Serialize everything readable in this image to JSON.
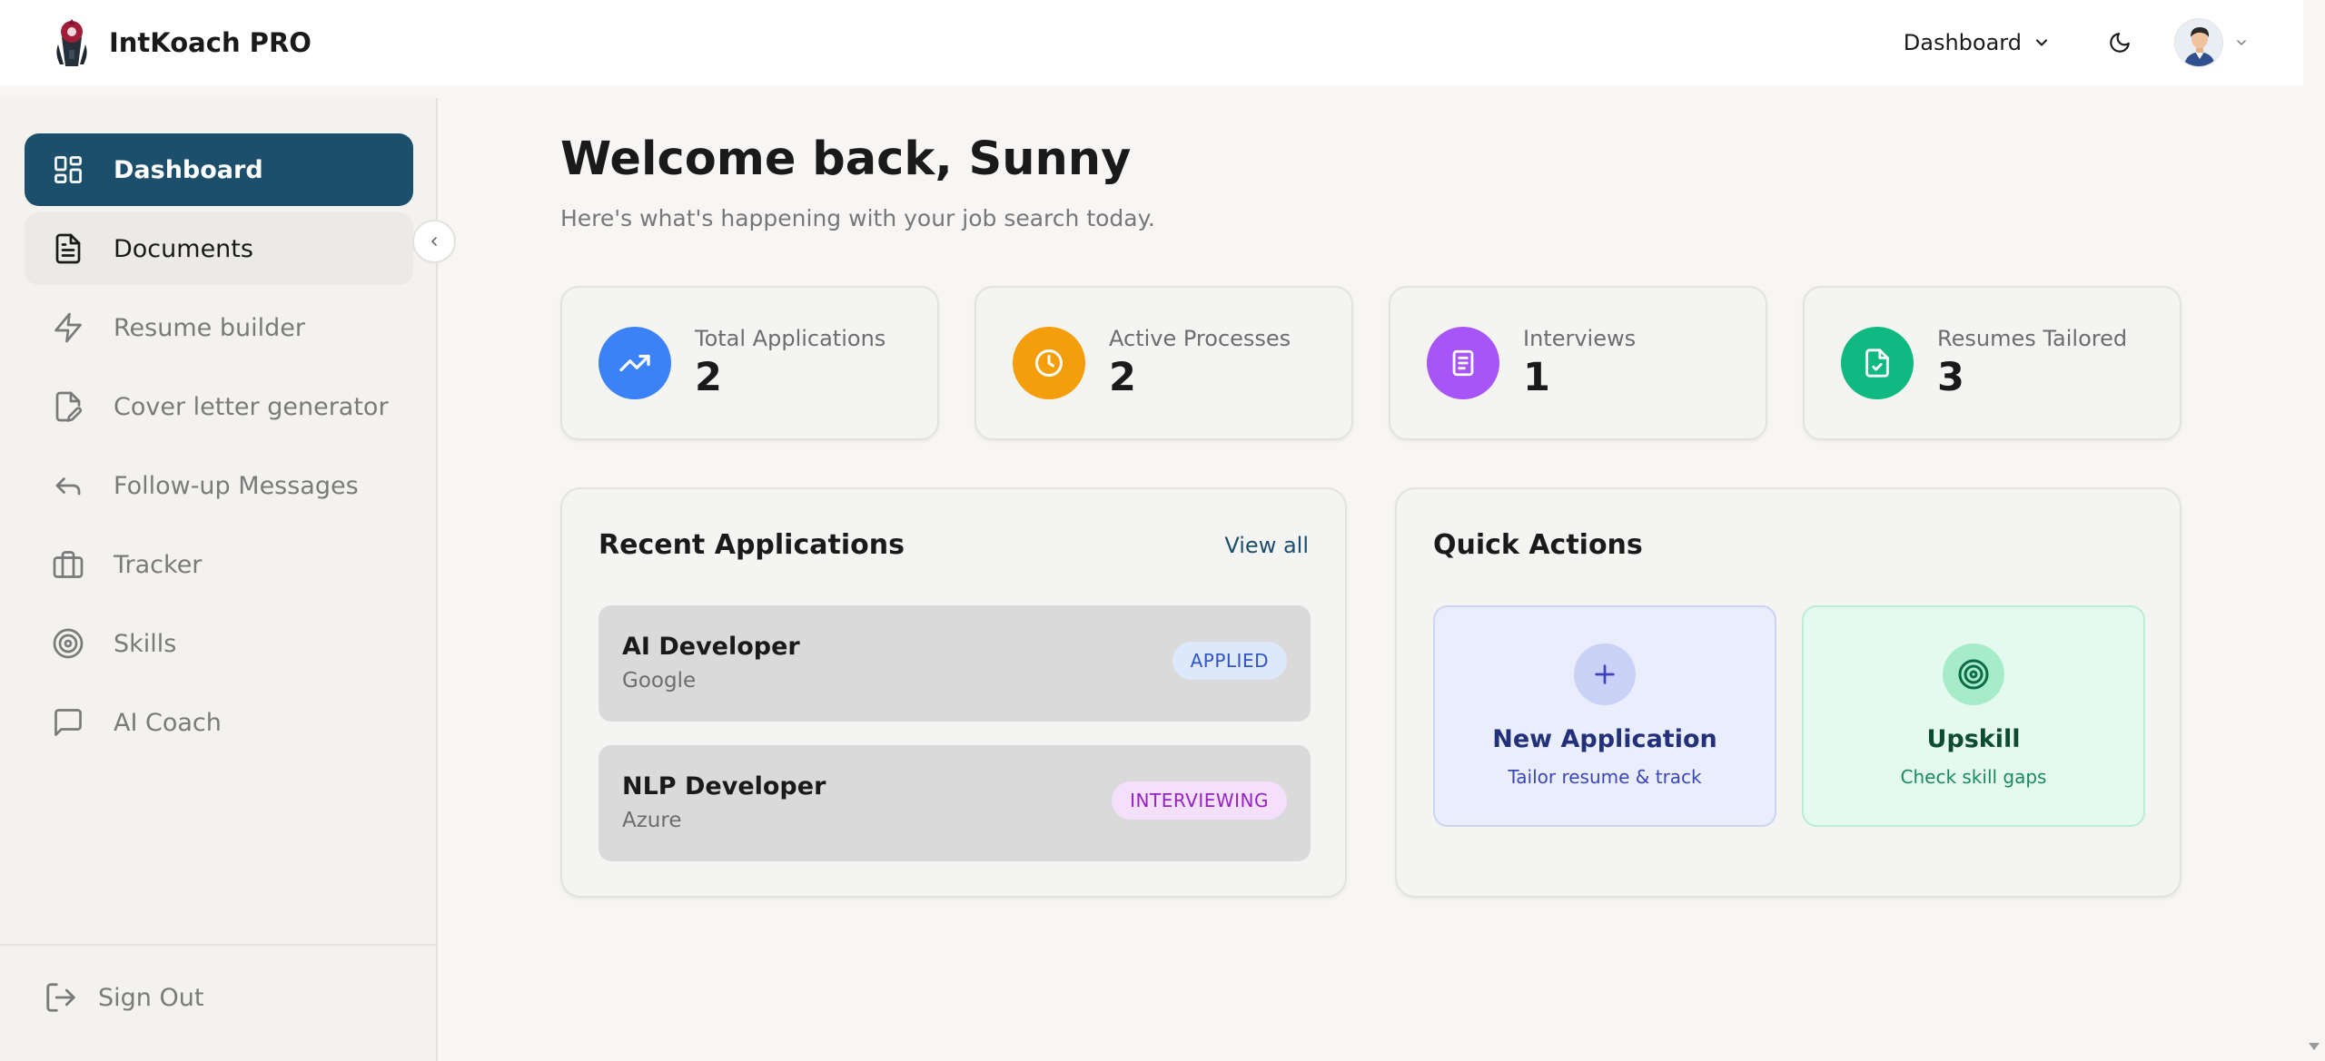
{
  "header": {
    "app_name": "IntKoach PRO",
    "nav_label": "Dashboard"
  },
  "sidebar": {
    "items": [
      {
        "label": "Dashboard",
        "icon": "layout-grid-icon"
      },
      {
        "label": "Documents",
        "icon": "file-text-icon"
      },
      {
        "label": "Resume builder",
        "icon": "zap-icon"
      },
      {
        "label": "Cover letter generator",
        "icon": "file-pen-icon"
      },
      {
        "label": "Follow-up Messages",
        "icon": "reply-icon"
      },
      {
        "label": "Tracker",
        "icon": "briefcase-icon"
      },
      {
        "label": "Skills",
        "icon": "target-icon"
      },
      {
        "label": "AI Coach",
        "icon": "message-square-icon"
      }
    ],
    "active": "Dashboard",
    "signout_label": "Sign Out"
  },
  "main": {
    "title": "Welcome back, Sunny",
    "subtitle": "Here's what's happening with your job search today.",
    "stats": [
      {
        "label": "Total Applications",
        "value": "2",
        "icon": "trending-up-icon",
        "color": "#3b82f6"
      },
      {
        "label": "Active Processes",
        "value": "2",
        "icon": "clock-icon",
        "color": "#f59e0b"
      },
      {
        "label": "Interviews",
        "value": "1",
        "icon": "book-icon",
        "color": "#a855f7"
      },
      {
        "label": "Resumes Tailored",
        "value": "3",
        "icon": "file-check-icon",
        "color": "#10b981"
      }
    ],
    "recent": {
      "title": "Recent Applications",
      "view_all": "View all",
      "items": [
        {
          "title": "AI Developer",
          "company": "Google",
          "status": "APPLIED"
        },
        {
          "title": "NLP Developer",
          "company": "Azure",
          "status": "INTERVIEWING"
        }
      ]
    },
    "quick_actions": {
      "title": "Quick Actions",
      "items": [
        {
          "title": "New Application",
          "subtitle": "Tailor resume & track",
          "icon": "plus-icon"
        },
        {
          "title": "Upskill",
          "subtitle": "Check skill gaps",
          "icon": "target-icon"
        }
      ]
    }
  },
  "colors": {
    "primary": "#1c4f6b",
    "applied_badge": "#2f55c8",
    "interviewing_badge": "#9422c4"
  }
}
